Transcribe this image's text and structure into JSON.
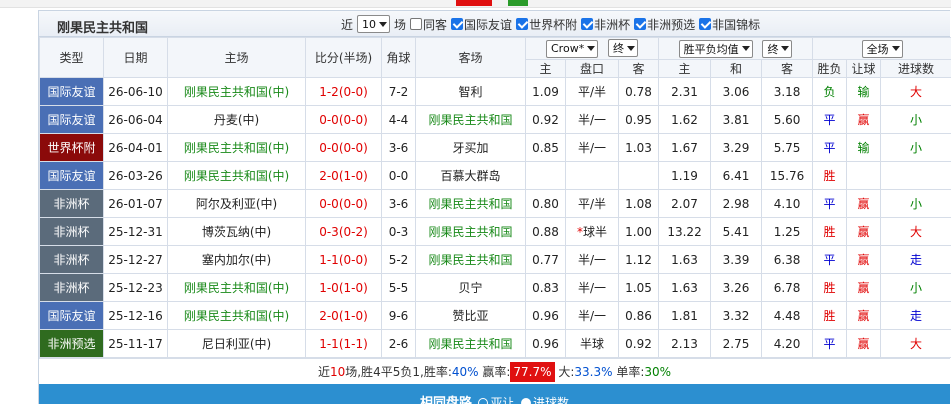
{
  "panel": {
    "title": "刚果民主共和国",
    "filters": {
      "recent_prefix": "近",
      "count_value": "10",
      "count_suffix": "场",
      "same_venue": "同客",
      "leagues": [
        "国际友谊",
        "世界杯附",
        "非洲杯",
        "非洲预选",
        "非国锦标"
      ]
    }
  },
  "columns": {
    "type": "类型",
    "date": "日期",
    "home": "主场",
    "score": "比分(半场)",
    "corner": "角球",
    "away": "客场",
    "bookmaker": "Crow*",
    "handicap_mode": "终",
    "euro_label": "胜平负均值",
    "euro_mode": "终",
    "all": "全场",
    "sub": {
      "home": "主",
      "line": "盘口",
      "away": "客",
      "e_home": "主",
      "e_draw": "和",
      "e_away": "客",
      "result": "胜负",
      "cover": "让球",
      "ou": "进球数"
    }
  },
  "colors": {
    "国际友谊": "#4a6fb5",
    "世界杯附": "#8b0a0a",
    "非洲杯": "#5b6b7b",
    "非洲预选": "#2f6b1f"
  },
  "rows": [
    {
      "league": "国际友谊",
      "date": "26-06-10",
      "home": "刚果民主共和国(中)",
      "home_team": true,
      "score": "1-2",
      "ht": "(0-0)",
      "corner": "7-2",
      "away": "智利",
      "away_team": false,
      "h": "1.09",
      "line": "平/半",
      "a": "0.78",
      "eh": "2.31",
      "ed": "3.06",
      "ea": "3.18",
      "res": "负",
      "cover": "输",
      "ou": "大"
    },
    {
      "league": "国际友谊",
      "date": "26-06-04",
      "home": "丹麦(中)",
      "home_team": false,
      "score": "0-0",
      "ht": "(0-0)",
      "corner": "4-4",
      "away": "刚果民主共和国",
      "away_team": true,
      "h": "0.92",
      "line": "半/一",
      "a": "0.95",
      "eh": "1.62",
      "ed": "3.81",
      "ea": "5.60",
      "res": "平",
      "cover": "赢",
      "ou": "小"
    },
    {
      "league": "世界杯附",
      "date": "26-04-01",
      "home": "刚果民主共和国(中)",
      "home_team": true,
      "score": "0-0",
      "ht": "(0-0)",
      "corner": "3-6",
      "away": "牙买加",
      "away_team": false,
      "h": "0.85",
      "line": "半/一",
      "a": "1.03",
      "eh": "1.67",
      "ed": "3.29",
      "ea": "5.75",
      "res": "平",
      "cover": "输",
      "ou": "小"
    },
    {
      "league": "国际友谊",
      "date": "26-03-26",
      "home": "刚果民主共和国(中)",
      "home_team": true,
      "score": "2-0",
      "ht": "(1-0)",
      "corner": "0-0",
      "away": "百慕大群岛",
      "away_team": false,
      "h": "",
      "line": "",
      "a": "",
      "eh": "1.19",
      "ed": "6.41",
      "ea": "15.76",
      "res": "胜",
      "cover": "",
      "ou": ""
    },
    {
      "league": "非洲杯",
      "date": "26-01-07",
      "home": "阿尔及利亚(中)",
      "home_team": false,
      "score": "0-0",
      "ht": "(0-0)",
      "corner": "3-6",
      "away": "刚果民主共和国",
      "away_team": true,
      "h": "0.80",
      "line": "平/半",
      "a": "1.08",
      "eh": "2.07",
      "ed": "2.98",
      "ea": "4.10",
      "res": "平",
      "cover": "赢",
      "ou": "小"
    },
    {
      "league": "非洲杯",
      "date": "25-12-31",
      "home": "博茨瓦纳(中)",
      "home_team": false,
      "score": "0-3",
      "ht": "(0-2)",
      "corner": "0-3",
      "away": "刚果民主共和国",
      "away_team": true,
      "h": "0.88",
      "line": "*球半",
      "a": "1.00",
      "eh": "13.22",
      "ed": "5.41",
      "ea": "1.25",
      "res": "胜",
      "cover": "赢",
      "ou": "大"
    },
    {
      "league": "非洲杯",
      "date": "25-12-27",
      "home": "塞内加尔(中)",
      "home_team": false,
      "score": "1-1",
      "ht": "(0-0)",
      "corner": "5-2",
      "away": "刚果民主共和国",
      "away_team": true,
      "h": "0.77",
      "line": "半/一",
      "a": "1.12",
      "eh": "1.63",
      "ed": "3.39",
      "ea": "6.38",
      "res": "平",
      "cover": "赢",
      "ou": "走"
    },
    {
      "league": "非洲杯",
      "date": "25-12-23",
      "home": "刚果民主共和国(中)",
      "home_team": true,
      "score": "1-0",
      "ht": "(1-0)",
      "corner": "5-5",
      "away": "贝宁",
      "away_team": false,
      "h": "0.83",
      "line": "半/一",
      "a": "1.05",
      "eh": "1.63",
      "ed": "3.26",
      "ea": "6.78",
      "res": "胜",
      "cover": "赢",
      "ou": "小"
    },
    {
      "league": "国际友谊",
      "date": "25-12-16",
      "home": "刚果民主共和国(中)",
      "home_team": true,
      "score": "2-0",
      "ht": "(1-0)",
      "corner": "9-6",
      "away": "赞比亚",
      "away_team": false,
      "h": "0.96",
      "line": "半/一",
      "a": "0.86",
      "eh": "1.81",
      "ed": "3.32",
      "ea": "4.48",
      "res": "胜",
      "cover": "赢",
      "ou": "走"
    },
    {
      "league": "非洲预选",
      "date": "25-11-17",
      "home": "尼日利亚(中)",
      "home_team": false,
      "score": "1-1",
      "ht": "(1-1)",
      "corner": "2-6",
      "away": "刚果民主共和国",
      "away_team": true,
      "h": "0.96",
      "line": "半球",
      "a": "0.92",
      "eh": "2.13",
      "ed": "2.75",
      "ea": "4.20",
      "res": "平",
      "cover": "赢",
      "ou": "大"
    }
  ],
  "summary": {
    "t1": "近",
    "n": "10",
    "t2": "场,胜",
    "w": "4",
    "t3": "平",
    "d": "5",
    "t4": "负",
    "l": "1",
    "t5": ",胜率:",
    "win_rate": "40%",
    "t6": " 赢率:",
    "cover_rate": "77.7%",
    "t7": " 大:",
    "over_rate": "33.3%",
    "t8": " 单率:",
    "odd_rate": "30%"
  },
  "footer": {
    "title": "相同盘路",
    "opt1": "亚让",
    "opt2": "进球数"
  }
}
